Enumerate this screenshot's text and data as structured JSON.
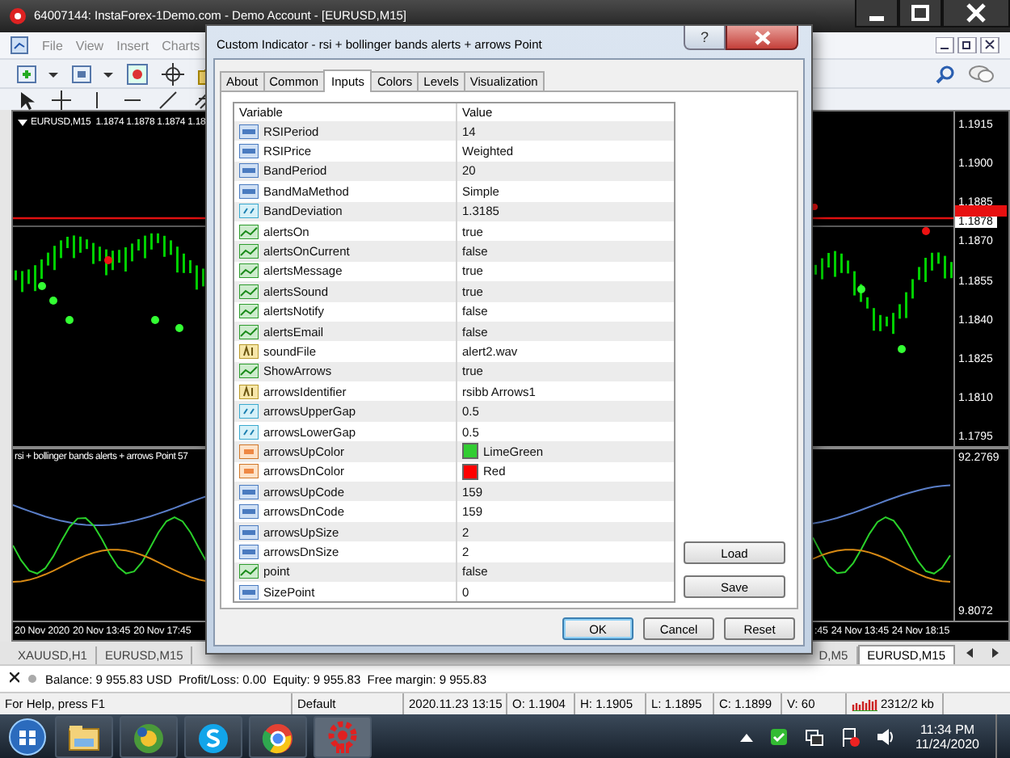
{
  "window": {
    "title": "64007144: InstaForex-1Demo.com - Demo Account - [EURUSD,M15]"
  },
  "menu": [
    "File",
    "View",
    "Insert",
    "Charts"
  ],
  "left_chart": {
    "header": "EURUSD,M15  1.1874 1.1878 1.1874 1.18",
    "indicator_label": "rsi + bollinger bands alerts + arrows Point 57",
    "time_labels": [
      "20 Nov 2020",
      "20 Nov 13:45",
      "20 Nov 17:45"
    ]
  },
  "right_chart": {
    "price_labels": [
      "1.1915",
      "1.1900",
      "1.1885",
      "1.1870",
      "1.1855",
      "1.1840",
      "1.1825",
      "1.1810",
      "1.1795"
    ],
    "current_price": "1.1878",
    "indicator_scale": [
      "92.2769",
      "9.8072"
    ],
    "time_labels": [
      ":45",
      "24 Nov 13:45",
      "24 Nov 18:15"
    ]
  },
  "chart_tabs": {
    "left": [
      {
        "label": "XAUUSD,H1",
        "selected": false
      },
      {
        "label": "EURUSD,M15",
        "selected": false
      }
    ],
    "right": [
      {
        "label": "D,M5",
        "selected": false
      },
      {
        "label": "EURUSD,M15",
        "selected": true
      }
    ]
  },
  "account_bar": "Balance: 9 955.83 USD  Profit/Loss: 0.00  Equity: 9 955.83  Free margin: 9 955.83",
  "status_bar": [
    "For Help, press F1",
    "Default",
    "2020.11.23 13:15",
    "O: 1.1904",
    "H: 1.1905",
    "L: 1.1895",
    "C: 1.1899",
    "V: 60",
    "2312/2 kb"
  ],
  "dialog": {
    "title": "Custom Indicator - rsi + bollinger bands alerts + arrows Point",
    "help": "?",
    "tabs": [
      {
        "label": "About",
        "selected": false
      },
      {
        "label": "Common",
        "selected": false
      },
      {
        "label": "Inputs",
        "selected": true
      },
      {
        "label": "Colors",
        "selected": false
      },
      {
        "label": "Levels",
        "selected": false
      },
      {
        "label": "Visualization",
        "selected": false
      }
    ],
    "columns": [
      "Variable",
      "Value"
    ],
    "inputs": [
      {
        "name": "RSIPeriod",
        "value": "14",
        "kind": "int"
      },
      {
        "name": "RSIPrice",
        "value": "Weighted",
        "kind": "int"
      },
      {
        "name": "BandPeriod",
        "value": "20",
        "kind": "int"
      },
      {
        "name": "BandMaMethod",
        "value": "Simple",
        "kind": "int"
      },
      {
        "name": "BandDeviation",
        "value": "1.3185",
        "kind": "double"
      },
      {
        "name": "alertsOn",
        "value": "true",
        "kind": "bool"
      },
      {
        "name": "alertsOnCurrent",
        "value": "false",
        "kind": "bool"
      },
      {
        "name": "alertsMessage",
        "value": "true",
        "kind": "bool"
      },
      {
        "name": "alertsSound",
        "value": "true",
        "kind": "bool"
      },
      {
        "name": "alertsNotify",
        "value": "false",
        "kind": "bool"
      },
      {
        "name": "alertsEmail",
        "value": "false",
        "kind": "bool"
      },
      {
        "name": "soundFile",
        "value": "alert2.wav",
        "kind": "string"
      },
      {
        "name": "ShowArrows",
        "value": "true",
        "kind": "bool"
      },
      {
        "name": "arrowsIdentifier",
        "value": "rsibb Arrows1",
        "kind": "string"
      },
      {
        "name": "arrowsUpperGap",
        "value": "0.5",
        "kind": "double"
      },
      {
        "name": "arrowsLowerGap",
        "value": "0.5",
        "kind": "double"
      },
      {
        "name": "arrowsUpColor",
        "value": "LimeGreen",
        "kind": "color",
        "color": "#32cd32"
      },
      {
        "name": "arrowsDnColor",
        "value": "Red",
        "kind": "color",
        "color": "#ff0000"
      },
      {
        "name": "arrowsUpCode",
        "value": "159",
        "kind": "int"
      },
      {
        "name": "arrowsDnCode",
        "value": "159",
        "kind": "int"
      },
      {
        "name": "arrowsUpSize",
        "value": "2",
        "kind": "int"
      },
      {
        "name": "arrowsDnSize",
        "value": "2",
        "kind": "int"
      },
      {
        "name": "point",
        "value": "false",
        "kind": "bool"
      },
      {
        "name": "SizePoint",
        "value": "0",
        "kind": "int"
      }
    ],
    "side_buttons": [
      "Load",
      "Save"
    ],
    "buttons": [
      "OK",
      "Cancel",
      "Reset"
    ]
  },
  "taskbar": {
    "time": "11:34 PM",
    "date": "11/24/2020"
  }
}
